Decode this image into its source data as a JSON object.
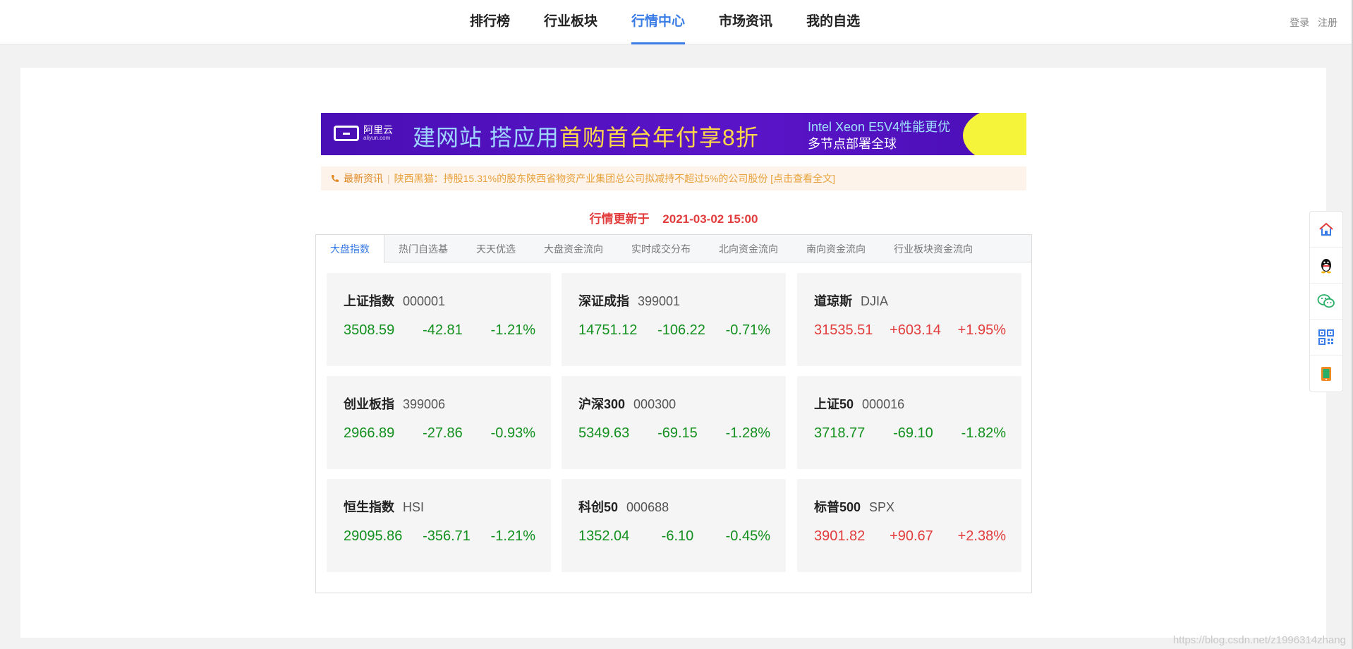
{
  "nav": {
    "items": [
      "排行榜",
      "行业板块",
      "行情中心",
      "市场资讯",
      "我的自选"
    ],
    "login": "登录",
    "register": "注册"
  },
  "ad": {
    "brand": "阿里云",
    "brand_domain": "aliyun.com",
    "slogan_a": "建网站 搭应用",
    "slogan_b": "首购首台年付享8折",
    "right_line1": "Intel Xeon E5V4性能更优",
    "right_line2": "多节点部署全球"
  },
  "news": {
    "tag": "最新资讯",
    "text": "陕西黑猫：持股15.31%的股东陕西省物资产业集团总公司拟减持不超过5%的公司股份 [点击查看全文]"
  },
  "update": {
    "label": "行情更新于",
    "time": "2021-03-02 15:00"
  },
  "tabs": [
    "大盘指数",
    "热门自选基",
    "天天优选",
    "大盘资金流向",
    "实时成交分布",
    "北向资金流向",
    "南向资金流向",
    "行业板块资金流向"
  ],
  "indices": [
    {
      "name": "上证指数",
      "code": "000001",
      "price": "3508.59",
      "change": "-42.81",
      "pct": "-1.21%",
      "trend": "down"
    },
    {
      "name": "深证成指",
      "code": "399001",
      "price": "14751.12",
      "change": "-106.22",
      "pct": "-0.71%",
      "trend": "down"
    },
    {
      "name": "道琼斯",
      "code": "DJIA",
      "price": "31535.51",
      "change": "+603.14",
      "pct": "+1.95%",
      "trend": "up"
    },
    {
      "name": "创业板指",
      "code": "399006",
      "price": "2966.89",
      "change": "-27.86",
      "pct": "-0.93%",
      "trend": "down"
    },
    {
      "name": "沪深300",
      "code": "000300",
      "price": "5349.63",
      "change": "-69.15",
      "pct": "-1.28%",
      "trend": "down"
    },
    {
      "name": "上证50",
      "code": "000016",
      "price": "3718.77",
      "change": "-69.10",
      "pct": "-1.82%",
      "trend": "down"
    },
    {
      "name": "恒生指数",
      "code": "HSI",
      "price": "29095.86",
      "change": "-356.71",
      "pct": "-1.21%",
      "trend": "down"
    },
    {
      "name": "科创50",
      "code": "000688",
      "price": "1352.04",
      "change": "-6.10",
      "pct": "-0.45%",
      "trend": "down"
    },
    {
      "name": "标普500",
      "code": "SPX",
      "price": "3901.82",
      "change": "+90.67",
      "pct": "+2.38%",
      "trend": "up"
    }
  ],
  "sidebar": [
    "home-icon",
    "qq-icon",
    "wechat-icon",
    "qrcode-icon",
    "mobile-icon"
  ],
  "watermark": "https://blog.csdn.net/z1996314zhang"
}
